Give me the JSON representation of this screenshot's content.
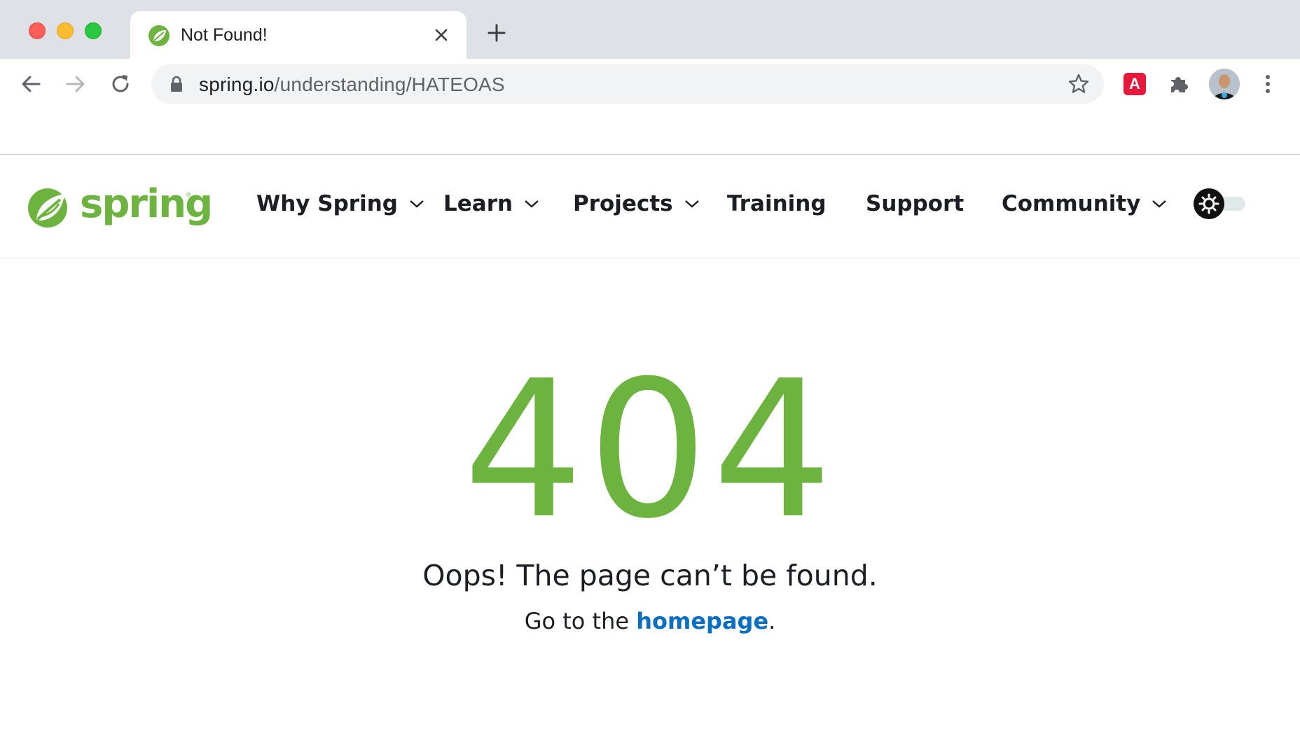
{
  "browser": {
    "tab_title": "Not Found!",
    "url_host": "spring.io",
    "url_path": "/understanding/HATEOAS",
    "extension_label": "A",
    "icons": [
      "back-arrow-icon",
      "forward-arrow-icon",
      "reload-icon",
      "lock-icon",
      "star-icon",
      "puzzle-icon",
      "kebab-menu-icon",
      "close-icon",
      "plus-icon"
    ]
  },
  "site": {
    "logo_text": "spring",
    "logo_mark": "®",
    "nav": {
      "why_spring": "Why Spring",
      "learn": "Learn",
      "projects": "Projects",
      "training": "Training",
      "support": "Support",
      "community": "Community"
    },
    "brand_color": "#6db33f"
  },
  "error": {
    "code": "404",
    "message": "Oops! The page can’t be found.",
    "goto_prefix": "Go to the ",
    "goto_link": "homepage",
    "goto_suffix": ".",
    "link_color": "#0a6fc2"
  }
}
